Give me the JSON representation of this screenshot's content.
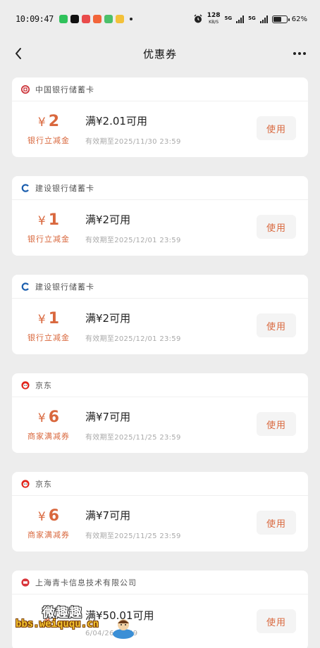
{
  "status_bar": {
    "time": "10:09:47",
    "net_speed_value": "128",
    "net_speed_unit": "KB/S",
    "signal_1_label": "5G",
    "signal_2_label": "5G",
    "battery_text": "62%",
    "battery_level": 0.62
  },
  "nav": {
    "title": "优惠券"
  },
  "coupons": [
    {
      "issuer": "中国银行储蓄卡",
      "issuer_icon": "bank-of-china-icon",
      "yen": "¥",
      "amount": "2",
      "type": "银行立减金",
      "condition": "满¥2.01可用",
      "expiry": "有效期至2025/11/30 23:59",
      "button": "使用"
    },
    {
      "issuer": "建设银行储蓄卡",
      "issuer_icon": "ccb-icon",
      "yen": "¥",
      "amount": "1",
      "type": "银行立减金",
      "condition": "满¥2可用",
      "expiry": "有效期至2025/12/01 23:59",
      "button": "使用"
    },
    {
      "issuer": "建设银行储蓄卡",
      "issuer_icon": "ccb-icon",
      "yen": "¥",
      "amount": "1",
      "type": "银行立减金",
      "condition": "满¥2可用",
      "expiry": "有效期至2025/12/01 23:59",
      "button": "使用"
    },
    {
      "issuer": "京东",
      "issuer_icon": "jd-icon",
      "yen": "¥",
      "amount": "6",
      "type": "商家满减券",
      "condition": "满¥7可用",
      "expiry": "有效期至2025/11/25 23:59",
      "button": "使用"
    },
    {
      "issuer": "京东",
      "issuer_icon": "jd-icon",
      "yen": "¥",
      "amount": "6",
      "type": "商家满减券",
      "condition": "满¥7可用",
      "expiry": "有效期至2025/11/25 23:59",
      "button": "使用"
    },
    {
      "issuer": "上海青卡信息技术有限公司",
      "issuer_icon": "company-seal-icon",
      "yen": "¥",
      "amount": "",
      "type": "",
      "condition": "满¥50.01可用",
      "expiry": "6/04/26 23:59",
      "button": "使用"
    }
  ],
  "watermark": {
    "title": "微趣趣",
    "url": "bbs.weiququ.cn"
  },
  "colors": {
    "accent": "#d9683e",
    "background": "#ededed",
    "card": "#ffffff"
  }
}
